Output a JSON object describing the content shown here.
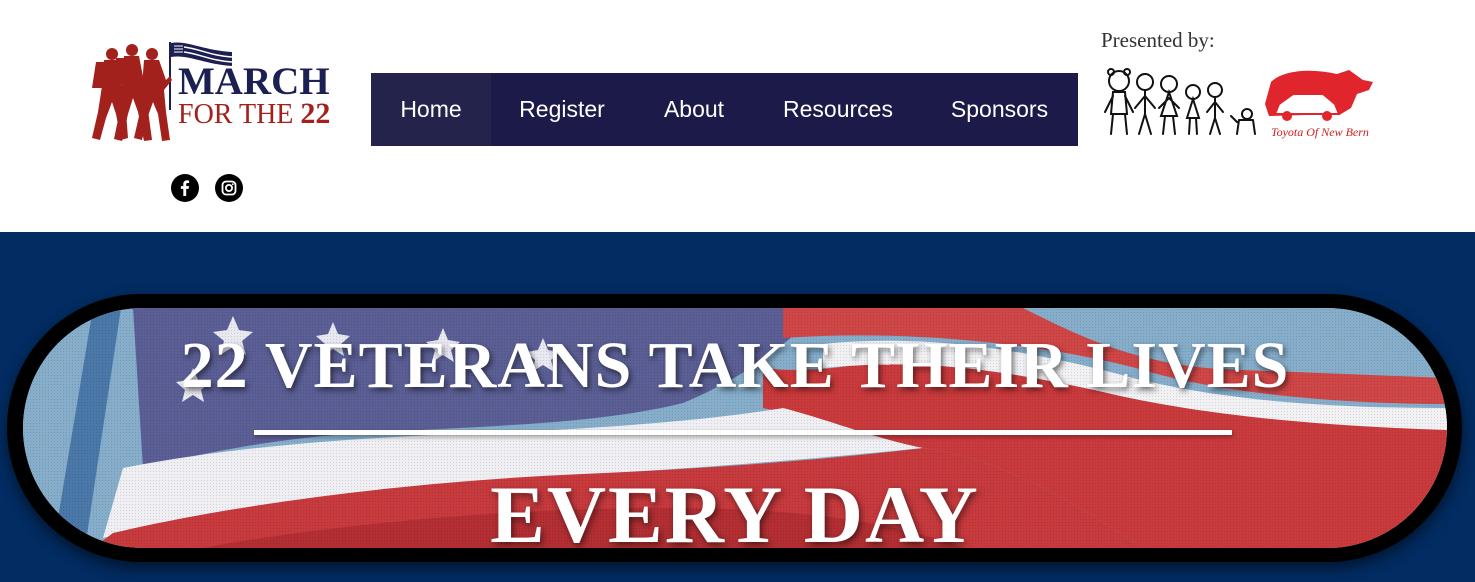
{
  "brand": {
    "line1": "MARCH",
    "line2_prefix": "FOR THE ",
    "line2_number": "22"
  },
  "nav": {
    "items": [
      {
        "label": "Home",
        "active": true
      },
      {
        "label": "Register",
        "active": false
      },
      {
        "label": "About",
        "active": false
      },
      {
        "label": "Resources",
        "active": false
      },
      {
        "label": "Sponsors",
        "active": false
      }
    ]
  },
  "social": {
    "items": [
      {
        "icon": "facebook-icon"
      },
      {
        "icon": "instagram-icon"
      }
    ]
  },
  "sponsor": {
    "presented_label": "Presented by:",
    "logo_text": "Toyota Of New Bern"
  },
  "hero": {
    "headline_line1": "22 VETERANS TAKE THEIR LIVES",
    "headline_line2": "EVERY DAY"
  },
  "colors": {
    "nav_bg": "#1c1a49",
    "hero_bg": "#022c62",
    "brand_navy": "#1c1f52",
    "brand_red": "#a3211c"
  }
}
